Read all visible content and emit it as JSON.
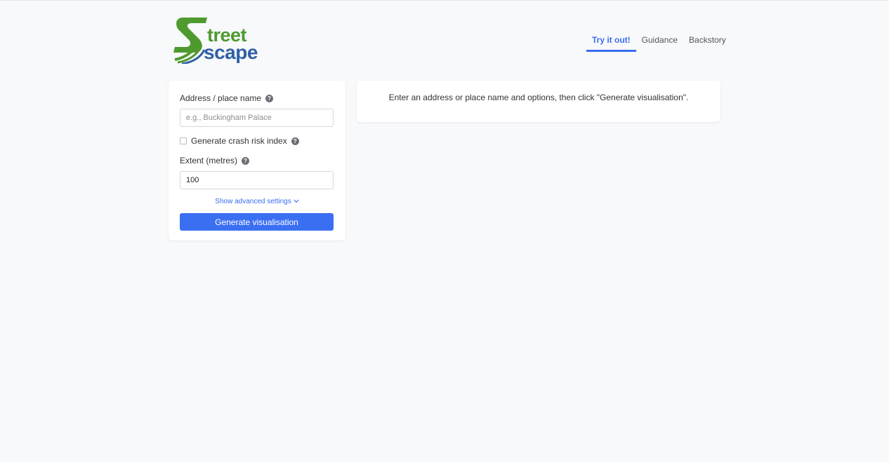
{
  "logo": {
    "word_top": "treet",
    "word_bottom": "scape",
    "colors": {
      "green": "#4e9a2f",
      "blue": "#2e5fa6"
    }
  },
  "nav": {
    "tabs": [
      {
        "label": "Try it out!",
        "active": true
      },
      {
        "label": "Guidance",
        "active": false
      },
      {
        "label": "Backstory",
        "active": false
      }
    ]
  },
  "form": {
    "address_label": "Address / place name",
    "address_placeholder": "e.g., Buckingham Palace",
    "address_value": "",
    "crash_risk_label": "Generate crash risk index",
    "crash_risk_checked": false,
    "extent_label": "Extent (metres)",
    "extent_value": "100",
    "advanced_label": "Show advanced settings",
    "submit_label": "Generate visualisation",
    "help_glyph": "?"
  },
  "message": {
    "text": "Enter an address or place name and options, then click \"Generate visualisation\"."
  },
  "colors": {
    "accent": "#3b6ff2",
    "background": "#f8f9fb"
  }
}
